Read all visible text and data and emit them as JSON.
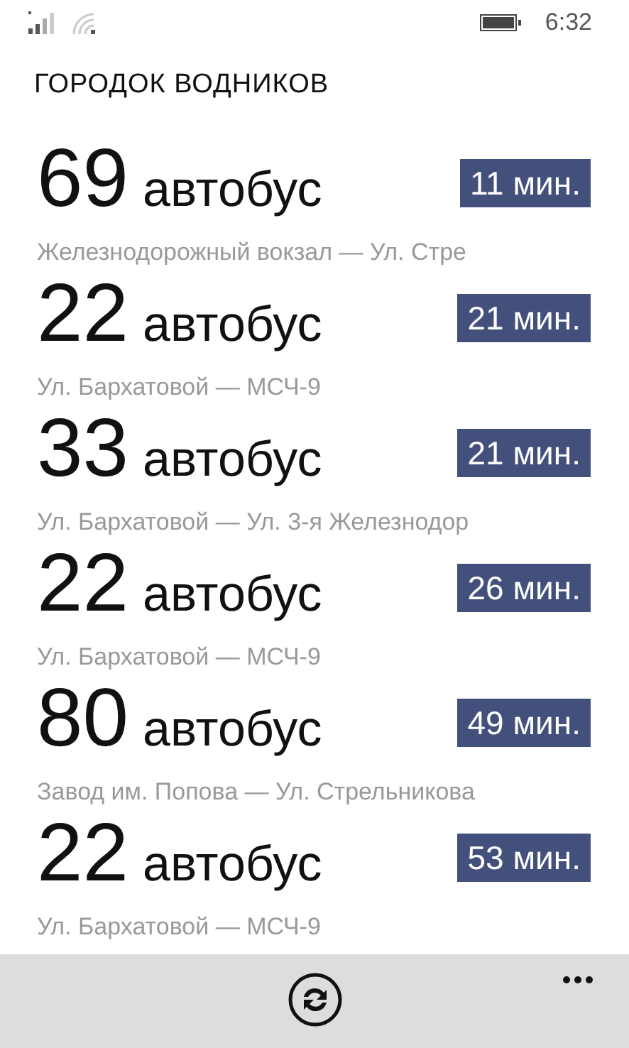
{
  "status_bar": {
    "time": "6:32"
  },
  "title": "ГОРОДОК ВОДНИКОВ",
  "arrivals": [
    {
      "number": "69",
      "type": "автобус",
      "eta": "11 мин.",
      "route": "Железнодорожный вокзал — Ул. Стре"
    },
    {
      "number": "22",
      "type": "автобус",
      "eta": "21 мин.",
      "route": "Ул. Бархатовой — МСЧ-9"
    },
    {
      "number": "33",
      "type": "автобус",
      "eta": "21 мин.",
      "route": "Ул. Бархатовой — Ул. 3-я Железнодор"
    },
    {
      "number": "22",
      "type": "автобус",
      "eta": "26 мин.",
      "route": "Ул. Бархатовой — МСЧ-9"
    },
    {
      "number": "80",
      "type": "автобус",
      "eta": "49 мин.",
      "route": "Завод им. Попова — Ул. Стрельникова"
    },
    {
      "number": "22",
      "type": "автобус",
      "eta": "53 мин.",
      "route": "Ул. Бархатовой — МСЧ-9"
    }
  ]
}
